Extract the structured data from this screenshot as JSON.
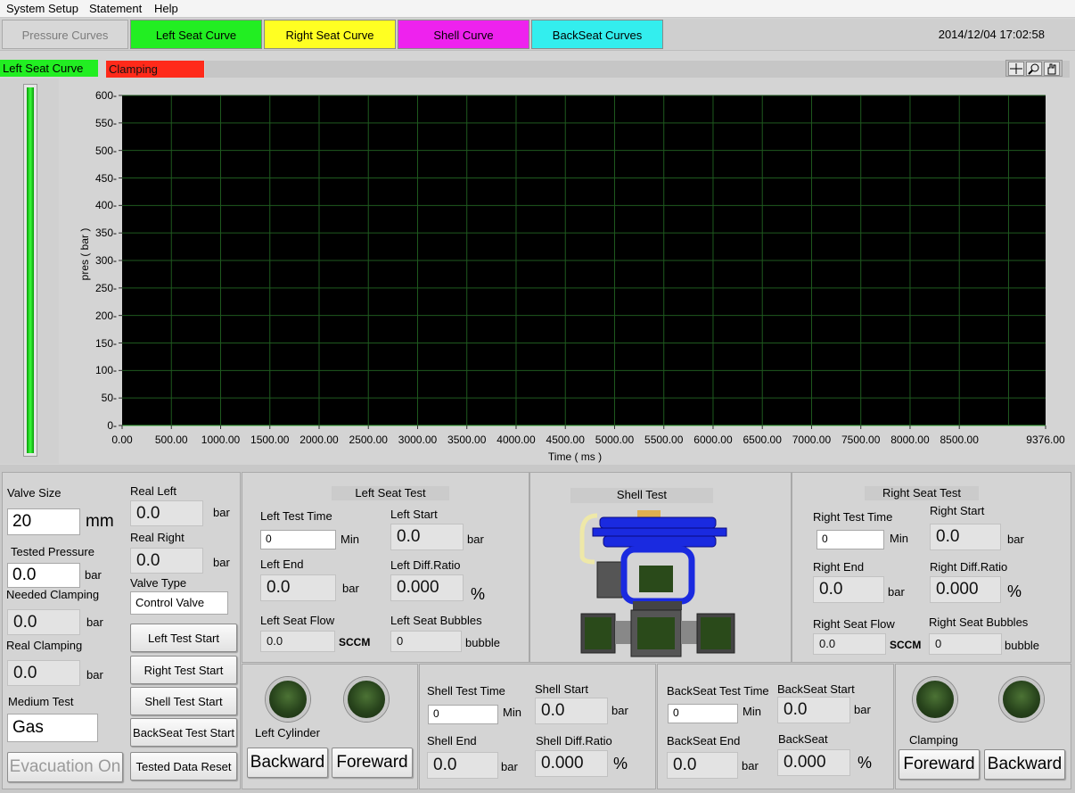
{
  "menu": [
    "System Setup",
    "Statement",
    "Help"
  ],
  "tabs": {
    "pressure_curves": "Pressure Curves",
    "left_seat_curve": "Left Seat Curve",
    "right_seat_curve": "Right Seat Curve",
    "shell_curve": "Shell Curve",
    "backseat_curves": "BackSeat Curves"
  },
  "datetime": "2014/12/04   17:02:58",
  "status": {
    "curve_label": "Left Seat  Curve",
    "state_label": "Clamping"
  },
  "colors": {
    "green": "#22ee22",
    "yellow": "#ffff22",
    "magenta": "#ee22ee",
    "cyan": "#33eeee",
    "red": "#ff2a1a"
  },
  "chart_data": {
    "type": "line",
    "title": "",
    "xlabel": "Time ( ms )",
    "ylabel": "pres ( bar )",
    "ylim": [
      0,
      600
    ],
    "xlim": [
      0,
      9376
    ],
    "yticks": [
      "0",
      "50",
      "100",
      "150",
      "200",
      "250",
      "300",
      "350",
      "400",
      "450",
      "500",
      "550",
      "600"
    ],
    "xticks": [
      "0.00",
      "500.00",
      "1000.00",
      "1500.00",
      "2000.00",
      "2500.00",
      "3000.00",
      "3500.00",
      "4000.00",
      "4500.00",
      "5000.00",
      "5500.00",
      "6000.00",
      "6500.00",
      "7000.00",
      "7500.00",
      "8000.00",
      "8500.00",
      "9376.00"
    ],
    "grid": true,
    "series": []
  },
  "graph_tools": [
    "crosshair-icon",
    "zoom-icon",
    "pan-hand-icon"
  ],
  "left_panel": {
    "valve_size_label": "Valve Size",
    "valve_size": "20",
    "valve_size_unit": "mm",
    "tested_pressure_label": "Tested Pressure",
    "tested_pressure": "0.0",
    "bar": "bar",
    "needed_clamping_label": "Needed Clamping",
    "needed_clamping": "0.0",
    "real_clamping_label": "Real Clamping",
    "real_clamping": "0.0",
    "medium_test_label": "Medium Test",
    "medium_test": "Gas",
    "evacuation_on": "Evacuation On",
    "real_left_label": "Real Left",
    "real_left": "0.0",
    "real_right_label": "Real Right",
    "real_right": "0.0",
    "valve_type_label": "Valve Type",
    "valve_type": "Control Valve",
    "left_test_start": "Left Test Start",
    "right_test_start": "Right Test Start",
    "shell_test_start": "Shell Test Start",
    "backseat_test_start": "BackSeat Test Start",
    "tested_data_reset": "Tested Data Reset"
  },
  "left_seat": {
    "title": "Left Seat Test",
    "test_time_label": "Left Test Time",
    "test_time": "0",
    "min": "Min",
    "start_label": "Left Start",
    "start": "0.0",
    "bar": "bar",
    "end_label": "Left End",
    "end": "0.0",
    "diff_label": "Left Diff.Ratio",
    "diff": "0.000",
    "pct": "%",
    "flow_label": "Left Seat Flow",
    "flow": "0.0",
    "sccm": "SCCM",
    "bubbles_label": "Left Seat Bubbles",
    "bubbles": "0",
    "bubble": "bubble"
  },
  "shell": {
    "title": "Shell Test",
    "test_time_label": "Shell Test Time",
    "test_time": "0",
    "min": "Min",
    "start_label": "Shell Start",
    "start": "0.0",
    "bar": "bar",
    "end_label": "Shell End",
    "end": "0.0",
    "diff_label": "Shell Diff.Ratio",
    "diff": "0.000",
    "pct": "%"
  },
  "right_seat": {
    "title": "Right Seat Test",
    "test_time_label": "Right Test Time",
    "test_time": "0",
    "min": "Min",
    "start_label": "Right Start",
    "start": "0.0",
    "bar": "bar",
    "end_label": "Right End",
    "end": "0.0",
    "diff_label": "Right  Diff.Ratio",
    "diff": "0.000",
    "pct": "%",
    "flow_label": "Right Seat Flow",
    "flow": "0.0",
    "sccm": "SCCM",
    "bubbles_label": "Right Seat Bubbles",
    "bubbles": "0",
    "bubble": "bubble"
  },
  "backseat": {
    "test_time_label": "BackSeat Test Time",
    "test_time": "0",
    "min": "Min",
    "start_label": "BackSeat  Start",
    "start": "0.0",
    "bar": "bar",
    "end_label": "BackSeat End",
    "end": "0.0",
    "diff_label": "BackSeat",
    "diff": "0.000",
    "pct": "%"
  },
  "cylinder": {
    "label": "Left Cylinder",
    "backward": "Backward",
    "foreward": "Foreward"
  },
  "clamping": {
    "label": "Clamping",
    "foreward": "Foreward",
    "backward": "Backward"
  }
}
